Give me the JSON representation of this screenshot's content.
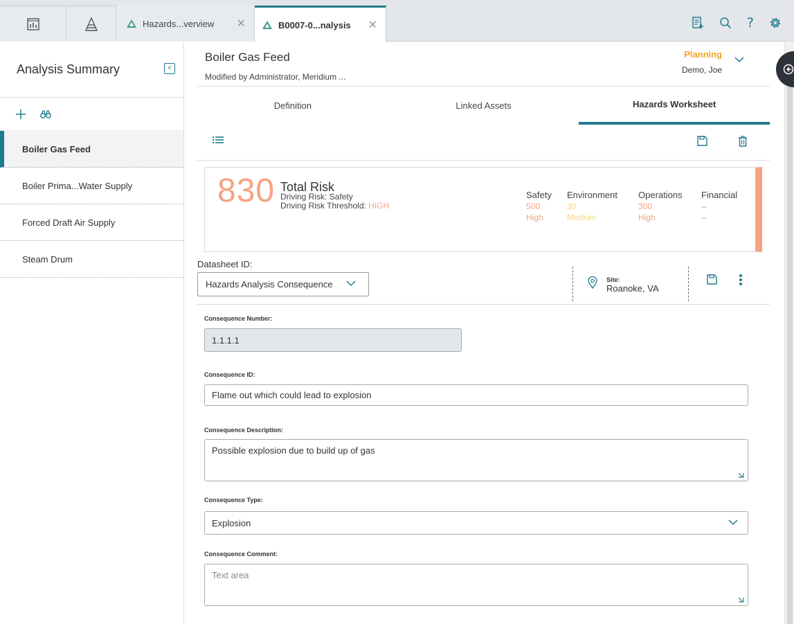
{
  "top_tabs": [
    {
      "label": "Hazards...verview"
    },
    {
      "label": "B0007-0...nalysis"
    }
  ],
  "sidebar": {
    "title": "Analysis Summary",
    "items": [
      {
        "label": "Boiler Gas Feed"
      },
      {
        "label": "Boiler Prima...Water Supply"
      },
      {
        "label": "Forced Draft Air Supply"
      },
      {
        "label": "Steam Drum"
      }
    ]
  },
  "record": {
    "title": "Boiler Gas Feed",
    "subtitle": "Modified by Administrator, Meridium ...",
    "state": "Planning",
    "state_owner": "Demo, Joe"
  },
  "tabs": [
    {
      "label": "Definition"
    },
    {
      "label": "Linked Assets"
    },
    {
      "label": "Hazards Worksheet"
    }
  ],
  "risk": {
    "total": "830",
    "total_label": "Total Risk",
    "driving_risk": "Driving Risk: Safety",
    "threshold_label": "Driving Risk Threshold:",
    "threshold_value": "HIGH",
    "categories": [
      {
        "name": "Safety",
        "value": "500",
        "level": "High",
        "color": "#f7a282"
      },
      {
        "name": "Environment",
        "value": "30",
        "level": "Medium",
        "color": "#f2d680"
      },
      {
        "name": "Operations",
        "value": "300",
        "level": "High",
        "color": "#f7a282"
      },
      {
        "name": "Financial",
        "value": "--",
        "level": "--",
        "color": "#999999"
      }
    ]
  },
  "datasheet": {
    "label": "Datasheet ID:",
    "value": "Hazards Analysis Consequence",
    "site_label": "Site:",
    "site_value": "Roanoke, VA"
  },
  "form": {
    "consequence_number": {
      "label": "Consequence Number:",
      "value": "1.1.1.1"
    },
    "consequence_id": {
      "label": "Consequence ID:",
      "value": "Flame out which could lead to explosion"
    },
    "consequence_description": {
      "label": "Consequence Description:",
      "value": "Possible explosion due to build up of gas"
    },
    "consequence_type": {
      "label": "Consequence Type:",
      "value": "Explosion"
    },
    "consequence_comment": {
      "label": "Consequence Comment:",
      "placeholder": "Text area"
    }
  },
  "colors": {
    "accent": "#1f7a8c",
    "high": "#f7a282",
    "medium": "#f2d680",
    "state": "#f5a623"
  }
}
